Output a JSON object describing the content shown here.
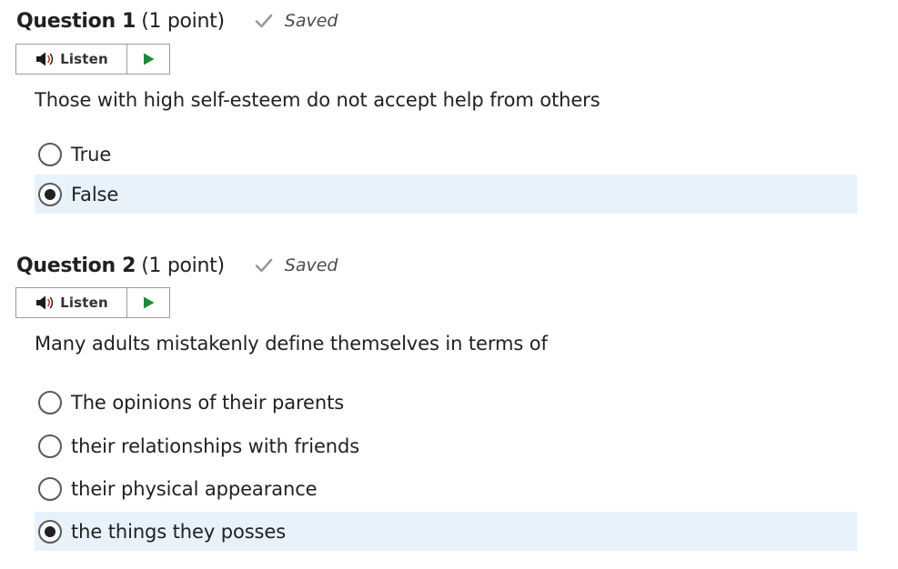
{
  "questions": [
    {
      "title": "Question 1",
      "points": "(1 point)",
      "status": "Saved",
      "listen_label": "Listen",
      "text": "Those with high self-esteem do not accept help from others",
      "options": [
        {
          "label": "True",
          "selected": false
        },
        {
          "label": "False",
          "selected": true
        }
      ]
    },
    {
      "title": "Question 2",
      "points": "(1 point)",
      "status": "Saved",
      "listen_label": "Listen",
      "text": "Many adults mistakenly define themselves in terms of",
      "options": [
        {
          "label": "The opinions of their parents",
          "selected": false
        },
        {
          "label": "their relationships with friends",
          "selected": false
        },
        {
          "label": "their physical appearance",
          "selected": false
        },
        {
          "label": "the things they posses",
          "selected": true
        }
      ]
    }
  ],
  "icons": {
    "status": "check-icon",
    "listen": "speaker-icon",
    "play": "play-icon"
  },
  "colors": {
    "selected_background": "#e8f2fb",
    "play_icon": "#1f8a3b",
    "check_icon": "#9a9a9a"
  }
}
